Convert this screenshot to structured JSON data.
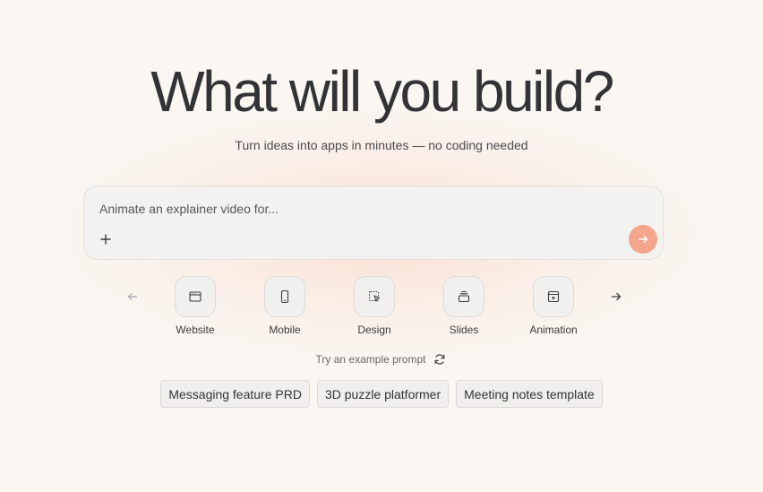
{
  "hero": {
    "title": "What will you build?",
    "subtitle": "Turn ideas into apps in minutes — no coding needed"
  },
  "prompt": {
    "placeholder": "Animate an explainer video for...",
    "value": "",
    "attach_icon": "plus-icon",
    "send_icon": "arrow-right-icon",
    "send_color": "#f4a58b"
  },
  "categories": {
    "prev_icon": "arrow-left-icon",
    "next_icon": "arrow-right-icon",
    "items": [
      {
        "label": "Website",
        "icon": "browser-window-icon"
      },
      {
        "label": "Mobile",
        "icon": "mobile-phone-icon"
      },
      {
        "label": "Design",
        "icon": "design-select-icon"
      },
      {
        "label": "Slides",
        "icon": "slides-stack-icon"
      },
      {
        "label": "Animation",
        "icon": "animation-play-icon"
      }
    ]
  },
  "examples": {
    "label": "Try an example prompt",
    "refresh_icon": "refresh-icon",
    "chips": [
      "Messaging feature PRD",
      "3D puzzle platformer",
      "Meeting notes template"
    ]
  },
  "colors": {
    "background": "#faf7f3",
    "accent": "#f4a58b"
  }
}
